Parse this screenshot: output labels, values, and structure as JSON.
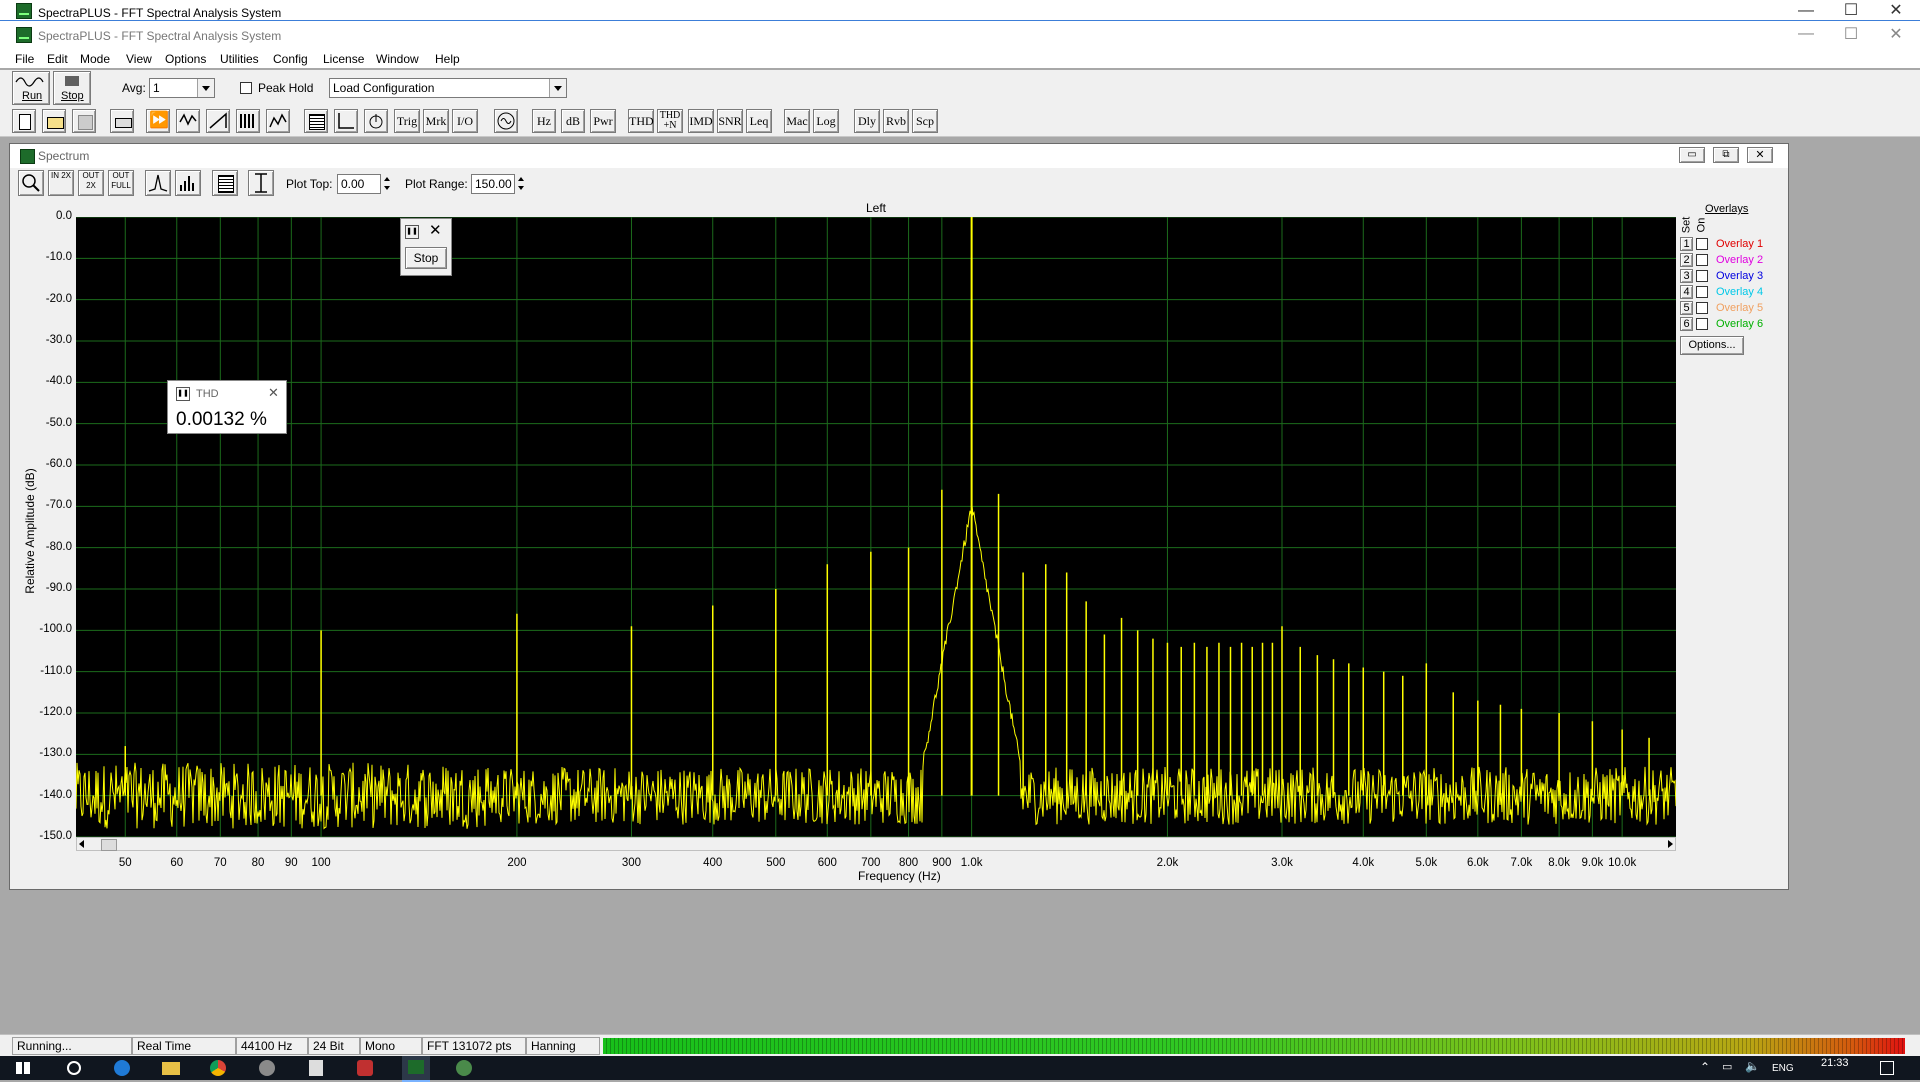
{
  "app": {
    "title_outer": "SpectraPLUS - FFT Spectral Analysis System",
    "title_inner": "SpectraPLUS - FFT Spectral Analysis System"
  },
  "menu": [
    "File",
    "Edit",
    "Mode",
    "View",
    "Options",
    "Utilities",
    "Config",
    "License",
    "Window",
    "Help"
  ],
  "toolbar": {
    "run_label": "Run",
    "stop_label": "Stop",
    "avg_label": "Avg:",
    "avg_value": "1",
    "peak_hold_label": "Peak Hold",
    "config_value": "Load Configuration",
    "text_buttons": [
      "Trig",
      "Mrk",
      "I/O",
      "Hz",
      "dB",
      "Pwr",
      "THD",
      "THD +N",
      "IMD",
      "SNR",
      "Leq",
      "Mac",
      "Log",
      "Dly",
      "Rvb",
      "Scp"
    ]
  },
  "spectrum": {
    "window_title": "Spectrum",
    "zoom_buttons": [
      "IN 2X",
      "OUT 2X",
      "OUT FULL"
    ],
    "plot_top_label": "Plot Top:",
    "plot_top_value": "0.00",
    "plot_range_label": "Plot Range:",
    "plot_range_value": "150.00",
    "channel_label": "Left"
  },
  "overlays": {
    "header": "Overlays",
    "set_label": "Set",
    "on_label": "On",
    "items": [
      {
        "num": "1",
        "label": "Overlay 1",
        "color": "#e00000"
      },
      {
        "num": "2",
        "label": "Overlay 2",
        "color": "#e000e0"
      },
      {
        "num": "3",
        "label": "Overlay 3",
        "color": "#0000e0"
      },
      {
        "num": "4",
        "label": "Overlay 4",
        "color": "#00c8e8"
      },
      {
        "num": "5",
        "label": "Overlay 5",
        "color": "#f0a060"
      },
      {
        "num": "6",
        "label": "Overlay 6",
        "color": "#00b000"
      }
    ],
    "options_label": "Options..."
  },
  "thd_popup": {
    "title": "THD",
    "value": "0.00132 %"
  },
  "stop_popup": {
    "label": "Stop"
  },
  "statusbar": {
    "state": "Running...",
    "mode": "Real Time",
    "rate": "44100 Hz",
    "bits": "24 Bit",
    "channels": "Mono",
    "fft": "FFT 131072 pts",
    "window": "Hanning"
  },
  "taskbar": {
    "lang": "ENG",
    "time": "21:33"
  },
  "chart_data": {
    "type": "line",
    "title": "Left",
    "xlabel": "Frequency (Hz)",
    "ylabel": "Relative Amplitude (dB)",
    "x_scale": "log",
    "xlim": [
      42,
      12100
    ],
    "ylim": [
      -150,
      0
    ],
    "grid": true,
    "y_ticks": [
      "0.0",
      "-10.0",
      "-20.0",
      "-30.0",
      "-40.0",
      "-50.0",
      "-60.0",
      "-70.0",
      "-80.0",
      "-90.0",
      "-100.0",
      "-110.0",
      "-120.0",
      "-130.0",
      "-140.0",
      "-150.0"
    ],
    "x_ticks": [
      {
        "v": 50,
        "label": "50"
      },
      {
        "v": 60,
        "label": "60"
      },
      {
        "v": 70,
        "label": "70"
      },
      {
        "v": 80,
        "label": "80"
      },
      {
        "v": 90,
        "label": "90"
      },
      {
        "v": 100,
        "label": "100"
      },
      {
        "v": 200,
        "label": "200"
      },
      {
        "v": 300,
        "label": "300"
      },
      {
        "v": 400,
        "label": "400"
      },
      {
        "v": 500,
        "label": "500"
      },
      {
        "v": 600,
        "label": "600"
      },
      {
        "v": 700,
        "label": "700"
      },
      {
        "v": 800,
        "label": "800"
      },
      {
        "v": 900,
        "label": "900"
      },
      {
        "v": 1000,
        "label": "1.0k"
      },
      {
        "v": 2000,
        "label": "2.0k"
      },
      {
        "v": 3000,
        "label": "3.0k"
      },
      {
        "v": 4000,
        "label": "4.0k"
      },
      {
        "v": 5000,
        "label": "5.0k"
      },
      {
        "v": 6000,
        "label": "6.0k"
      },
      {
        "v": 7000,
        "label": "7.0k"
      },
      {
        "v": 8000,
        "label": "8.0k"
      },
      {
        "v": 9000,
        "label": "9.0k"
      },
      {
        "v": 10000,
        "label": "10.0k"
      }
    ],
    "noise_floor": -140,
    "series": [
      {
        "color": "#ffff00",
        "peaks": [
          {
            "f": 50,
            "db": -128
          },
          {
            "f": 100,
            "db": -100
          },
          {
            "f": 200,
            "db": -96
          },
          {
            "f": 300,
            "db": -99
          },
          {
            "f": 400,
            "db": -94
          },
          {
            "f": 500,
            "db": -90
          },
          {
            "f": 600,
            "db": -84
          },
          {
            "f": 700,
            "db": -81
          },
          {
            "f": 800,
            "db": -80
          },
          {
            "f": 900,
            "db": -66
          },
          {
            "f": 1000,
            "db": 0
          },
          {
            "f": 1100,
            "db": -67
          },
          {
            "f": 1200,
            "db": -86
          },
          {
            "f": 1300,
            "db": -84
          },
          {
            "f": 1400,
            "db": -86
          },
          {
            "f": 1500,
            "db": -93
          },
          {
            "f": 1600,
            "db": -101
          },
          {
            "f": 1700,
            "db": -97
          },
          {
            "f": 1800,
            "db": -100
          },
          {
            "f": 1900,
            "db": -102
          },
          {
            "f": 2000,
            "db": -103
          },
          {
            "f": 2100,
            "db": -104
          },
          {
            "f": 2200,
            "db": -103
          },
          {
            "f": 2300,
            "db": -104
          },
          {
            "f": 2400,
            "db": -103
          },
          {
            "f": 2500,
            "db": -104
          },
          {
            "f": 2600,
            "db": -103
          },
          {
            "f": 2700,
            "db": -104
          },
          {
            "f": 2800,
            "db": -103
          },
          {
            "f": 2900,
            "db": -103
          },
          {
            "f": 3000,
            "db": -99
          },
          {
            "f": 3200,
            "db": -104
          },
          {
            "f": 3400,
            "db": -106
          },
          {
            "f": 3600,
            "db": -107
          },
          {
            "f": 3800,
            "db": -108
          },
          {
            "f": 4000,
            "db": -109
          },
          {
            "f": 4300,
            "db": -110
          },
          {
            "f": 4600,
            "db": -111
          },
          {
            "f": 5000,
            "db": -108
          },
          {
            "f": 5500,
            "db": -115
          },
          {
            "f": 6000,
            "db": -117
          },
          {
            "f": 6500,
            "db": -118
          },
          {
            "f": 7000,
            "db": -119
          },
          {
            "f": 8000,
            "db": -120
          },
          {
            "f": 9000,
            "db": -122
          },
          {
            "f": 10000,
            "db": -124
          },
          {
            "f": 11000,
            "db": -126
          }
        ]
      }
    ]
  }
}
